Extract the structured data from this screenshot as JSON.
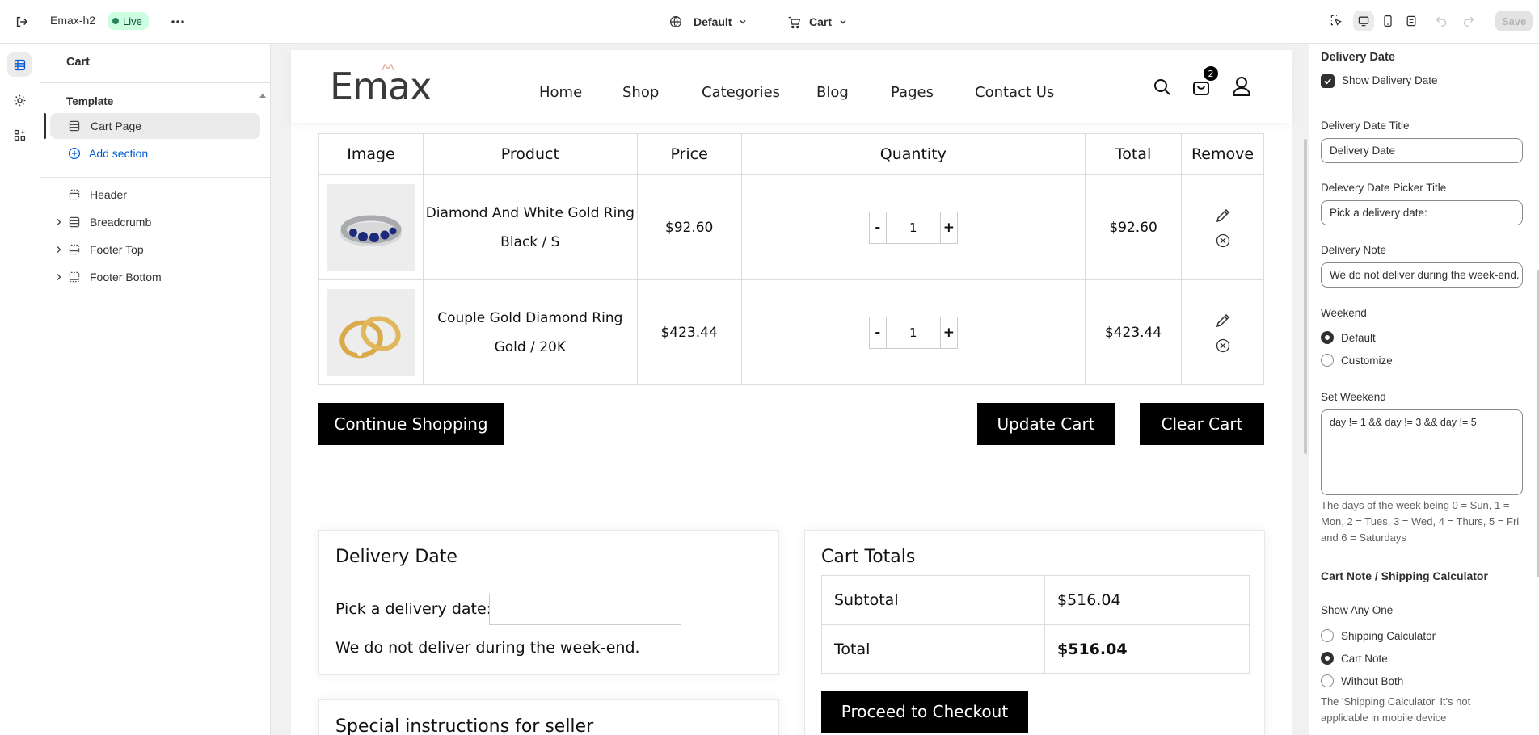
{
  "topbar": {
    "store_name": "Emax-h2",
    "live_badge": "Live",
    "theme_select": "Default",
    "page_select": "Cart",
    "save_label": "Save"
  },
  "sidebar": {
    "title": "Cart",
    "template_label": "Template",
    "template_item": "Cart Page",
    "add_section": "Add section",
    "sections": [
      "Header",
      "Breadcrumb",
      "Footer Top",
      "Footer Bottom"
    ]
  },
  "store": {
    "logo": "Emax",
    "nav": [
      "Home",
      "Shop",
      "Categories",
      "Blog",
      "Pages",
      "Contact Us"
    ],
    "cart_count": "2",
    "table_headers": [
      "Image",
      "Product",
      "Price",
      "Quantity",
      "Total",
      "Remove"
    ],
    "items": [
      {
        "name": "Diamond And White Gold Ring",
        "variant": "Black / S",
        "price": "$92.60",
        "qty": "1",
        "total": "$92.60"
      },
      {
        "name": "Couple Gold Diamond Ring",
        "variant": "Gold / 20K",
        "price": "$423.44",
        "qty": "1",
        "total": "$423.44"
      }
    ],
    "qty_minus": "-",
    "qty_plus": "+",
    "continue_shopping": "Continue Shopping",
    "update_cart": "Update Cart",
    "clear_cart": "Clear Cart",
    "delivery": {
      "title": "Delivery Date",
      "picker_label": "Pick a delivery date:",
      "note": "We do not deliver during the week-end."
    },
    "special_instructions": "Special instructions for seller",
    "totals": {
      "title": "Cart Totals",
      "subtotal_label": "Subtotal",
      "subtotal_value": "$516.04",
      "total_label": "Total",
      "total_value": "$516.04",
      "checkout": "Proceed to Checkout"
    }
  },
  "settings": {
    "section_title": "Delivery Date",
    "show_delivery_label": "Show Delivery Date",
    "show_delivery_checked": true,
    "title_label": "Delivery Date Title",
    "title_value": "Delivery Date",
    "picker_label": "Delevery Date Picker Title",
    "picker_value": "Pick a delivery date:",
    "note_label": "Delivery Note",
    "note_value": "We do not deliver during the week-end.",
    "weekend_label": "Weekend",
    "weekend_options": [
      "Default",
      "Customize"
    ],
    "weekend_selected": "Default",
    "set_weekend_label": "Set Weekend",
    "set_weekend_value": "day != 1 && day != 3 && day != 5",
    "weekend_help": "The days of the week being 0 = Sun, 1 = Mon, 2 = Tues, 3 = Wed, 4 = Thurs, 5 = Fri and 6 = Saturdays",
    "cart_note_title": "Cart Note / Shipping Calculator",
    "show_any_label": "Show Any One",
    "show_any_options": [
      "Shipping Calculator",
      "Cart Note",
      "Without Both"
    ],
    "show_any_selected": "Cart Note",
    "shipping_help": "The 'Shipping Calculator' It's not applicable in mobile device"
  },
  "colors": {
    "accent_green": "#29845a",
    "live_bg": "#cdfee1",
    "link_blue": "#005bd3",
    "black": "#000000"
  }
}
